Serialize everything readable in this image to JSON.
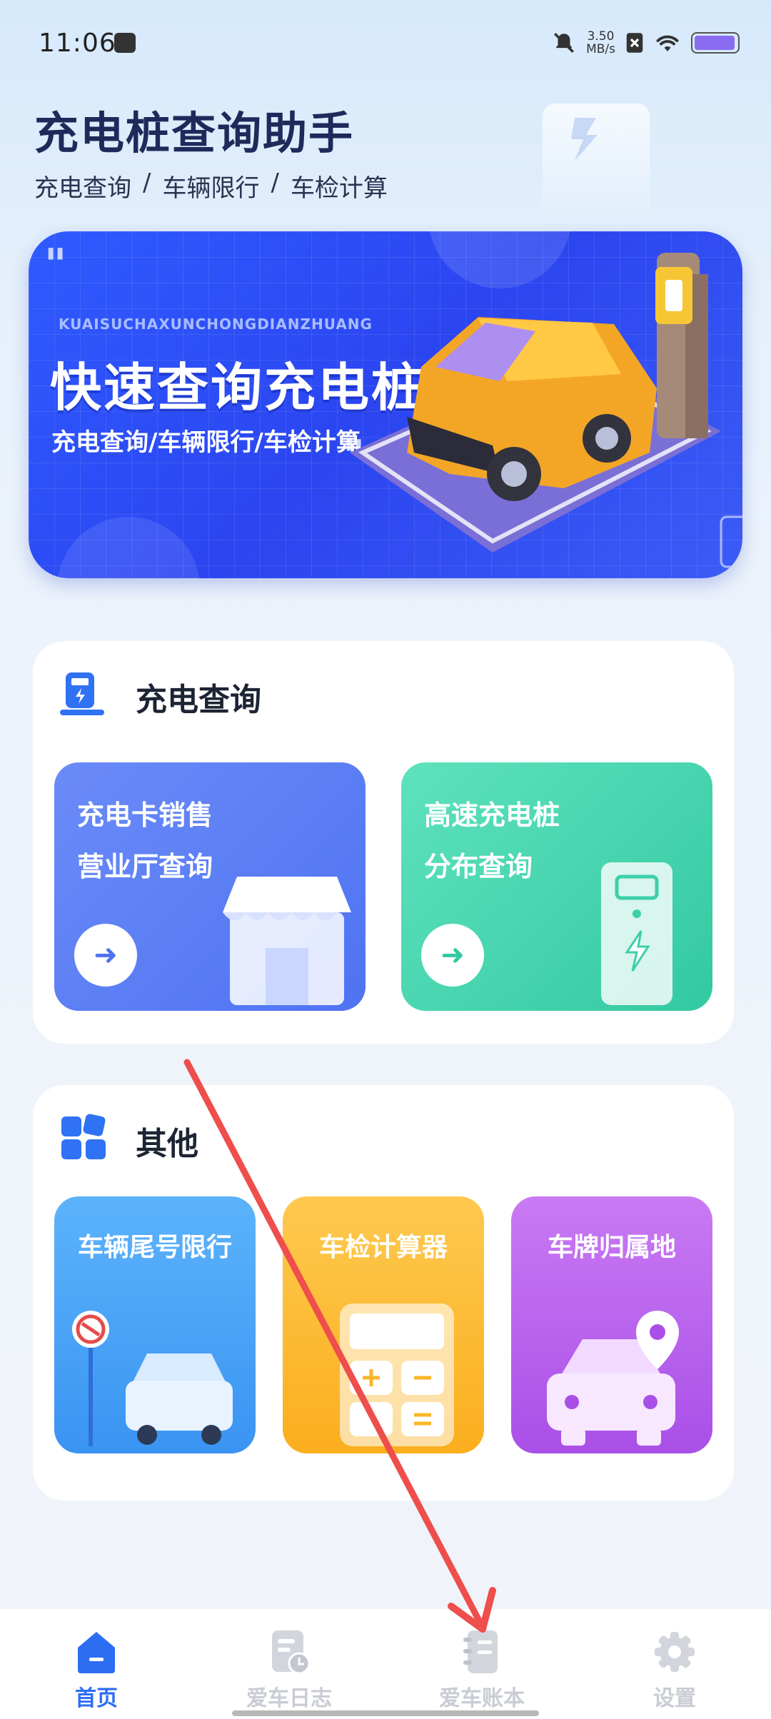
{
  "status_bar": {
    "time": "11:06",
    "net_speed_value": "3.50",
    "net_speed_unit": "MB/s"
  },
  "header": {
    "title": "充电桩查询助手",
    "subtitle_items": [
      "充电查询",
      "车辆限行",
      "车检计算"
    ],
    "separator": "/"
  },
  "banner": {
    "pinyin": "KUAISUCHAXUNCHONGDIANZHUANG",
    "title": "快速查询充电桩",
    "subtitle": "充电查询/车辆限行/车检计算"
  },
  "charge_section": {
    "title": "充电查询",
    "tiles": [
      {
        "line1": "充电卡销售",
        "line2": "营业厅查询",
        "arrow": "➜",
        "color": "#5b7ef5"
      },
      {
        "line1": "高速充电桩",
        "line2": "分布查询",
        "arrow": "➜",
        "color": "#3fd3ae"
      }
    ]
  },
  "other_section": {
    "title": "其他",
    "tiles": [
      {
        "label": "车辆尾号限行",
        "color": "#4aa5f7"
      },
      {
        "label": "车检计算器",
        "color": "#fdbb33"
      },
      {
        "label": "车牌归属地",
        "color": "#b765ee"
      }
    ]
  },
  "bottom_nav": {
    "items": [
      {
        "label": "首页",
        "icon": "home-icon",
        "active": true
      },
      {
        "label": "爱车日志",
        "icon": "car-log-icon",
        "active": false
      },
      {
        "label": "爱车账本",
        "icon": "notebook-icon",
        "active": false
      },
      {
        "label": "设置",
        "icon": "gear-icon",
        "active": false
      }
    ],
    "active_color": "#2c6df2",
    "inactive_color": "#c9ccd4"
  }
}
